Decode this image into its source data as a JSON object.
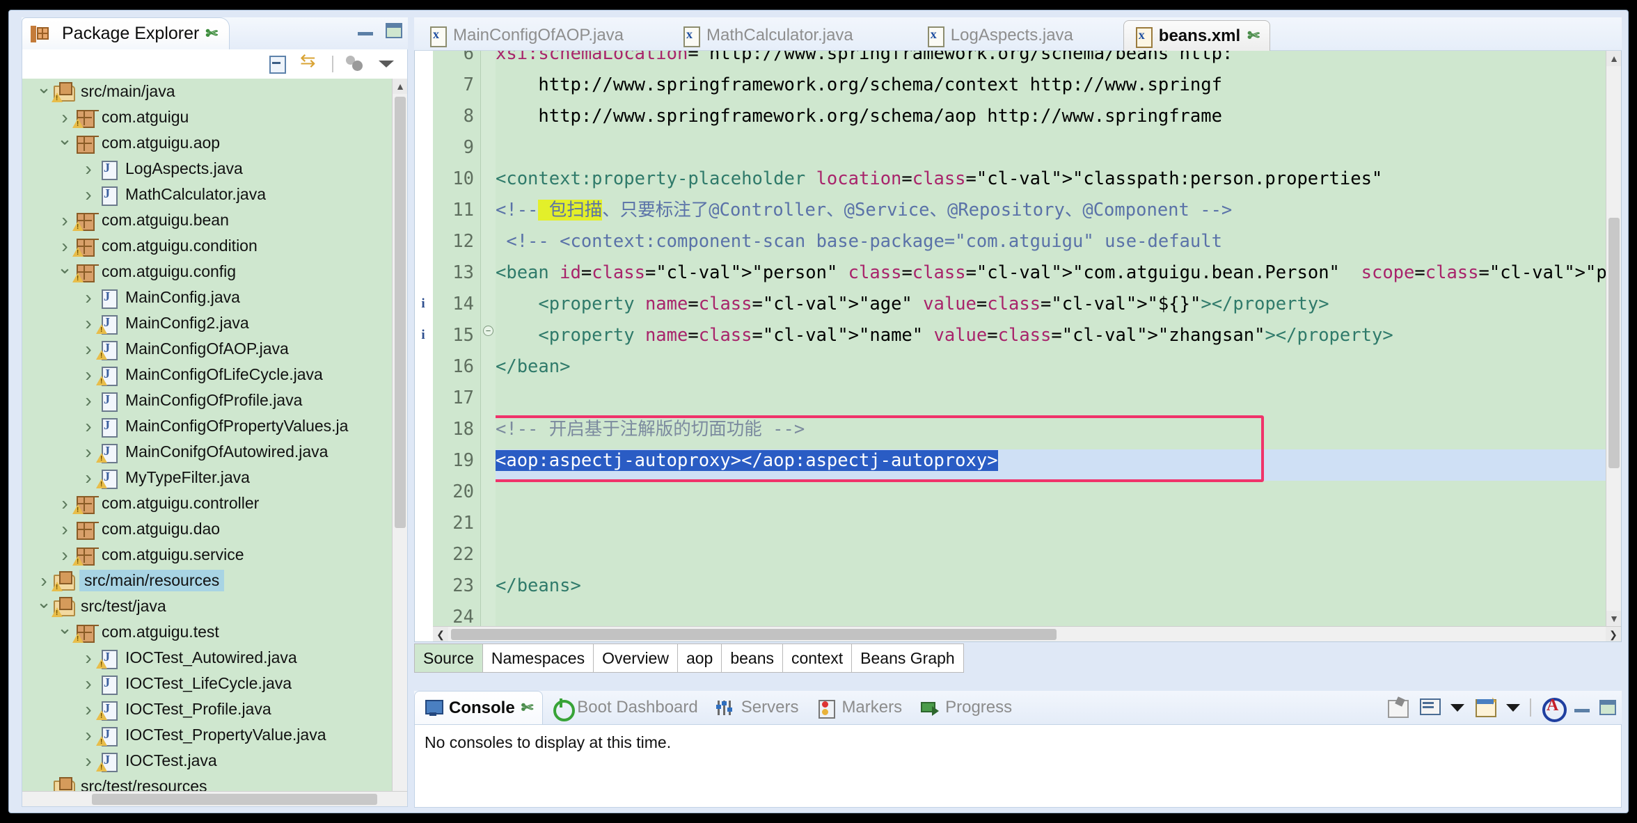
{
  "package_explorer": {
    "title": "Package Explorer",
    "close_glyph": "✄",
    "toolbar": [
      {
        "name": "collapse-all-icon",
        "label": "Collapse All"
      },
      {
        "name": "link-with-editor-icon",
        "label": "Link with Editor"
      },
      {
        "name": "focus-on-active-task-icon",
        "label": "Focus on Active Task"
      },
      {
        "name": "view-menu-icon",
        "label": "View Menu"
      }
    ],
    "tree": [
      {
        "label": "src/main/java",
        "icon": "source-folder",
        "indent": 0,
        "arrow": "open",
        "warn": true,
        "selected": false
      },
      {
        "label": "com.atguigu",
        "icon": "package",
        "indent": 1,
        "arrow": "closed",
        "warn": true,
        "selected": false
      },
      {
        "label": "com.atguigu.aop",
        "icon": "package",
        "indent": 1,
        "arrow": "open",
        "warn": false,
        "selected": false
      },
      {
        "label": "LogAspects.java",
        "icon": "java-file",
        "indent": 2,
        "arrow": "closed",
        "warn": false,
        "selected": false
      },
      {
        "label": "MathCalculator.java",
        "icon": "java-file",
        "indent": 2,
        "arrow": "closed",
        "warn": false,
        "selected": false
      },
      {
        "label": "com.atguigu.bean",
        "icon": "package",
        "indent": 1,
        "arrow": "closed",
        "warn": true,
        "selected": false
      },
      {
        "label": "com.atguigu.condition",
        "icon": "package",
        "indent": 1,
        "arrow": "closed",
        "warn": true,
        "selected": false
      },
      {
        "label": "com.atguigu.config",
        "icon": "package",
        "indent": 1,
        "arrow": "open",
        "warn": true,
        "selected": false
      },
      {
        "label": "MainConfig.java",
        "icon": "java-file",
        "indent": 2,
        "arrow": "closed",
        "warn": false,
        "selected": false
      },
      {
        "label": "MainConfig2.java",
        "icon": "java-file",
        "indent": 2,
        "arrow": "closed",
        "warn": true,
        "selected": false
      },
      {
        "label": "MainConfigOfAOP.java",
        "icon": "java-file",
        "indent": 2,
        "arrow": "closed",
        "warn": true,
        "selected": false
      },
      {
        "label": "MainConfigOfLifeCycle.java",
        "icon": "java-file",
        "indent": 2,
        "arrow": "closed",
        "warn": true,
        "selected": false
      },
      {
        "label": "MainConfigOfProfile.java",
        "icon": "java-file",
        "indent": 2,
        "arrow": "closed",
        "warn": false,
        "selected": false
      },
      {
        "label": "MainConfigOfPropertyValues.ja",
        "icon": "java-file",
        "indent": 2,
        "arrow": "closed",
        "warn": false,
        "selected": false
      },
      {
        "label": "MainConifgOfAutowired.java",
        "icon": "java-file",
        "indent": 2,
        "arrow": "closed",
        "warn": true,
        "selected": false
      },
      {
        "label": "MyTypeFilter.java",
        "icon": "java-file",
        "indent": 2,
        "arrow": "closed",
        "warn": true,
        "selected": false
      },
      {
        "label": "com.atguigu.controller",
        "icon": "package",
        "indent": 1,
        "arrow": "closed",
        "warn": true,
        "selected": false
      },
      {
        "label": "com.atguigu.dao",
        "icon": "package",
        "indent": 1,
        "arrow": "closed",
        "warn": false,
        "selected": false
      },
      {
        "label": "com.atguigu.service",
        "icon": "package",
        "indent": 1,
        "arrow": "closed",
        "warn": true,
        "selected": false
      },
      {
        "label": "src/main/resources",
        "icon": "source-folder",
        "indent": 0,
        "arrow": "closed",
        "warn": true,
        "selected": true
      },
      {
        "label": "src/test/java",
        "icon": "source-folder",
        "indent": 0,
        "arrow": "open",
        "warn": true,
        "selected": false
      },
      {
        "label": "com.atguigu.test",
        "icon": "package",
        "indent": 1,
        "arrow": "open",
        "warn": true,
        "selected": false
      },
      {
        "label": "IOCTest_Autowired.java",
        "icon": "java-file",
        "indent": 2,
        "arrow": "closed",
        "warn": true,
        "selected": false
      },
      {
        "label": "IOCTest_LifeCycle.java",
        "icon": "java-file",
        "indent": 2,
        "arrow": "closed",
        "warn": false,
        "selected": false
      },
      {
        "label": "IOCTest_Profile.java",
        "icon": "java-file",
        "indent": 2,
        "arrow": "closed",
        "warn": true,
        "selected": false
      },
      {
        "label": "IOCTest_PropertyValue.java",
        "icon": "java-file",
        "indent": 2,
        "arrow": "closed",
        "warn": true,
        "selected": false
      },
      {
        "label": "IOCTest.java",
        "icon": "java-file",
        "indent": 2,
        "arrow": "closed",
        "warn": true,
        "selected": false
      },
      {
        "label": "src/test/resources",
        "icon": "source-folder",
        "indent": 0,
        "arrow": "none",
        "warn": false,
        "selected": false
      }
    ]
  },
  "editor": {
    "tabs": [
      {
        "label": "MainConfigOfAOP.java",
        "icon": "java-file-icon",
        "active": false
      },
      {
        "label": "MathCalculator.java",
        "icon": "java-file-icon",
        "active": false
      },
      {
        "label": "LogAspects.java",
        "icon": "java-file-icon",
        "active": false
      },
      {
        "label": "beans.xml",
        "icon": "xml-file-icon",
        "active": true
      }
    ],
    "active_tab_close": "✄",
    "lines": [
      {
        "n": "6",
        "text": "xsi:schemaLocation=\"http://www.springframework.org/schema/beans http:"
      },
      {
        "n": "7",
        "text": "    http://www.springframework.org/schema/context http://www.springf"
      },
      {
        "n": "8",
        "text": "    http://www.springframework.org/schema/aop http://www.springframe"
      },
      {
        "n": "9",
        "text": ""
      },
      {
        "n": "10",
        "text": "<context:property-placeholder location=\"classpath:person.properties\""
      },
      {
        "n": "11",
        "text": "<!-- 包扫描、只要标注了@Controller、@Service、@Repository、@Component -->"
      },
      {
        "n": "12",
        "text": " <!-- <context:component-scan base-package=\"com.atguigu\" use-default"
      },
      {
        "n": "13",
        "text": "<bean id=\"person\" class=\"com.atguigu.bean.Person\"  scope=\"prototype\""
      },
      {
        "n": "14",
        "text": "    <property name=\"age\" value=\"${}\"></property>"
      },
      {
        "n": "15",
        "text": "    <property name=\"name\" value=\"zhangsan\"></property>"
      },
      {
        "n": "16",
        "text": "</bean>"
      },
      {
        "n": "17",
        "text": ""
      },
      {
        "n": "18",
        "text": "<!-- 开启基于注解版的切面功能 -->"
      },
      {
        "n": "19",
        "text": "<aop:aspectj-autoproxy></aop:aspectj-autoproxy>"
      },
      {
        "n": "20",
        "text": ""
      },
      {
        "n": "21",
        "text": ""
      },
      {
        "n": "22",
        "text": ""
      },
      {
        "n": "23",
        "text": "</beans>"
      },
      {
        "n": "24",
        "text": ""
      }
    ],
    "markers": [
      {
        "line": "14",
        "glyph": "i"
      },
      {
        "line": "15",
        "glyph": "i"
      }
    ],
    "fold_marker_line": "13",
    "selected_line": "19",
    "highlight_color": "#f0336a",
    "bottom_tabs": [
      {
        "label": "Source",
        "active": true
      },
      {
        "label": "Namespaces",
        "active": false
      },
      {
        "label": "Overview",
        "active": false
      },
      {
        "label": "aop",
        "active": false
      },
      {
        "label": "beans",
        "active": false
      },
      {
        "label": "context",
        "active": false
      },
      {
        "label": "Beans Graph",
        "active": false
      }
    ]
  },
  "console": {
    "tabs": [
      {
        "label": "Console",
        "icon": "console-icon",
        "active": true,
        "close": "✄"
      },
      {
        "label": "Boot Dashboard",
        "icon": "boot-dashboard-icon",
        "active": false
      },
      {
        "label": "Servers",
        "icon": "servers-icon",
        "active": false
      },
      {
        "label": "Markers",
        "icon": "markers-icon",
        "active": false
      },
      {
        "label": "Progress",
        "icon": "progress-icon",
        "active": false
      }
    ],
    "message": "No consoles to display at this time.",
    "tools": [
      {
        "name": "pin-console-icon"
      },
      {
        "name": "display-selected-console-icon"
      },
      {
        "name": "open-console-icon"
      },
      {
        "name": "atguigu-icon"
      }
    ]
  }
}
